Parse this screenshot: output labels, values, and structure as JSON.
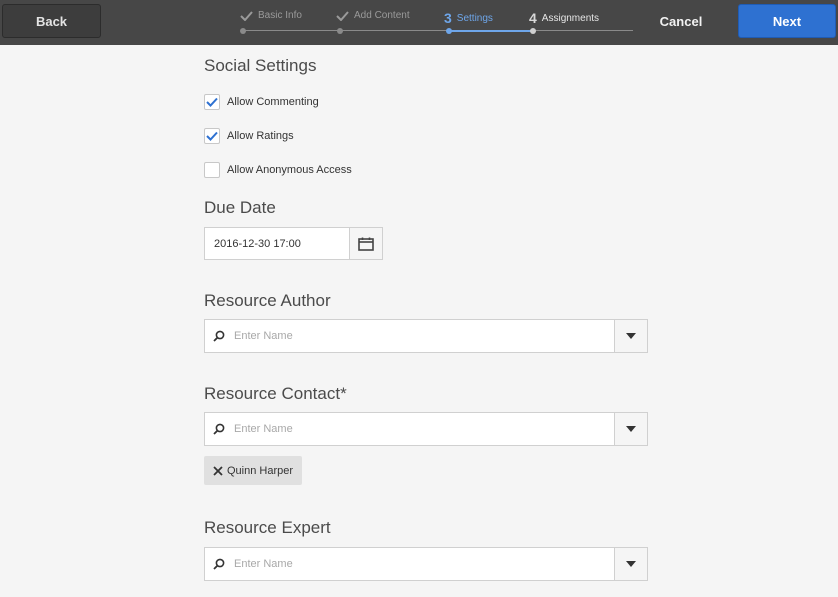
{
  "topbar": {
    "back_label": "Back",
    "cancel_label": "Cancel",
    "next_label": "Next",
    "steps": [
      {
        "num": "",
        "label": "Basic Info",
        "state": "done"
      },
      {
        "num": "",
        "label": "Add Content",
        "state": "done"
      },
      {
        "num": "3",
        "label": "Settings",
        "state": "current"
      },
      {
        "num": "4",
        "label": "Assignments",
        "state": "todo"
      }
    ]
  },
  "social": {
    "title": "Social Settings",
    "options": [
      {
        "label": "Allow Commenting",
        "checked": true
      },
      {
        "label": "Allow Ratings",
        "checked": true
      },
      {
        "label": "Allow Anonymous Access",
        "checked": false
      }
    ]
  },
  "due_date": {
    "title": "Due Date",
    "value": "2016-12-30 17:00"
  },
  "resource_author": {
    "title": "Resource Author",
    "placeholder": "Enter Name"
  },
  "resource_contact": {
    "title": "Resource Contact*",
    "placeholder": "Enter Name",
    "selected": "Quinn Harper"
  },
  "resource_expert": {
    "title": "Resource Expert",
    "placeholder": "Enter Name"
  },
  "colors": {
    "accent": "#2e71d1",
    "check": "#2e71d1",
    "topbar": "#474747"
  }
}
